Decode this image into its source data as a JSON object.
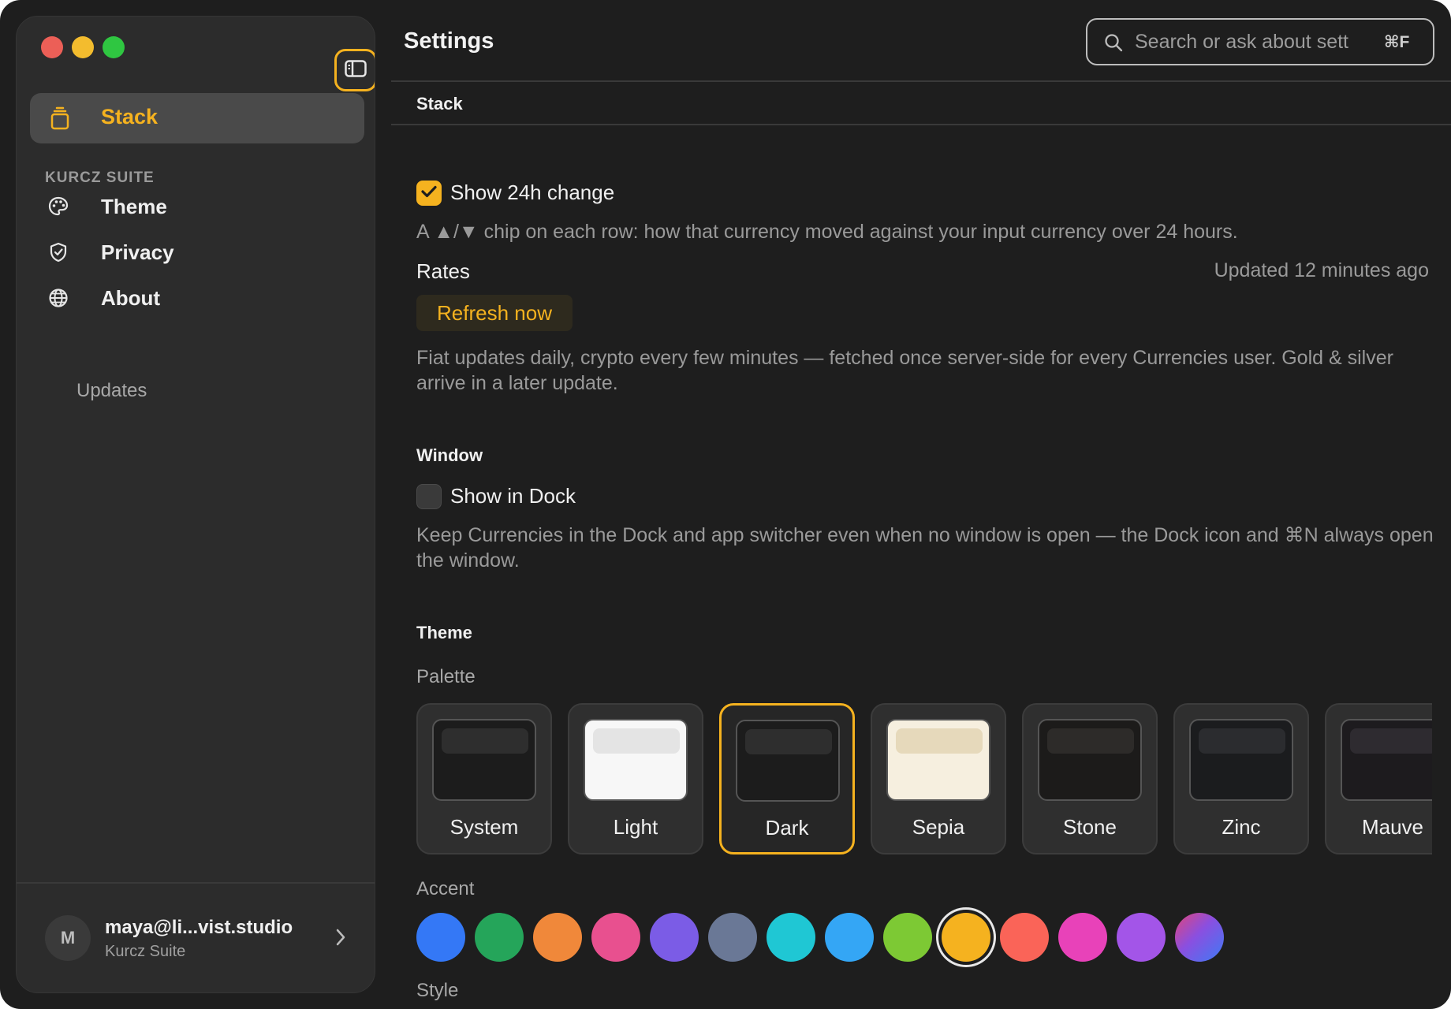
{
  "colors": {
    "accent": "#f5b21f",
    "window_bg": "#1e1e1e",
    "sidebar_bg": "#2c2c2c"
  },
  "sidebar": {
    "toggle_icon": "sidebar-toggle-icon",
    "active_item": {
      "label": "Stack",
      "icon": "stack-icon"
    },
    "section_label": "KURCZ SUITE",
    "items": [
      {
        "label": "Theme",
        "icon": "palette-icon"
      },
      {
        "label": "Privacy",
        "icon": "shield-icon"
      },
      {
        "label": "About",
        "icon": "globe-icon"
      }
    ],
    "sub_item": "Updates",
    "account": {
      "initial": "M",
      "email": "maya@li...vist.studio",
      "org": "Kurcz Suite"
    }
  },
  "header": {
    "title": "Settings",
    "search": {
      "placeholder": "Search or ask about sett",
      "shortcut": "⌘F"
    }
  },
  "stack": {
    "heading": "Stack",
    "show_24h": {
      "label": "Show 24h change",
      "checked": true,
      "description": "A ▲/▼ chip on each row: how that currency moved against your input currency over 24 hours."
    },
    "rates": {
      "label": "Rates",
      "updated": "Updated 12 minutes ago",
      "refresh_label": "Refresh now",
      "description": "Fiat updates daily, crypto every few minutes — fetched once server-side for every Currencies user. Gold & silver arrive in a later update."
    }
  },
  "window": {
    "heading": "Window",
    "show_in_dock": {
      "label": "Show in Dock",
      "checked": false,
      "description": "Keep Currencies in the Dock and app switcher even when no window is open — the Dock icon and ⌘N always open the window."
    }
  },
  "theme": {
    "heading": "Theme",
    "palette_label": "Palette",
    "palettes": [
      {
        "name": "System",
        "preview_bg": "#1c1c1c",
        "bar": "#2e2e2e",
        "selected": false
      },
      {
        "name": "Light",
        "preview_bg": "#f7f7f7",
        "bar": "#e4e4e4",
        "selected": false
      },
      {
        "name": "Dark",
        "preview_bg": "#1c1c1c",
        "bar": "#2e2e2e",
        "selected": true
      },
      {
        "name": "Sepia",
        "preview_bg": "#f6efdf",
        "bar": "#e6d9bb",
        "selected": false
      },
      {
        "name": "Stone",
        "preview_bg": "#1c1b1a",
        "bar": "#2d2b29",
        "selected": false
      },
      {
        "name": "Zinc",
        "preview_bg": "#1b1c1e",
        "bar": "#2b2c2f",
        "selected": false
      },
      {
        "name": "Mauve",
        "preview_bg": "#1d1b1e",
        "bar": "#2e2b30",
        "selected": false
      }
    ],
    "accent_label": "Accent",
    "accents": [
      {
        "color": "#3478f6",
        "selected": false
      },
      {
        "color": "#25a55a",
        "selected": false
      },
      {
        "color": "#f0883a",
        "selected": false
      },
      {
        "color": "#e8508f",
        "selected": false
      },
      {
        "color": "#7b5ce6",
        "selected": false
      },
      {
        "color": "#6a7896",
        "selected": false
      },
      {
        "color": "#1fc7d4",
        "selected": false
      },
      {
        "color": "#34a6f5",
        "selected": false
      },
      {
        "color": "#7dc934",
        "selected": false
      },
      {
        "color": "#f5b21f",
        "selected": true
      },
      {
        "color": "#fa6458",
        "selected": false
      },
      {
        "color": "#e842b9",
        "selected": false
      },
      {
        "color": "#a355e8",
        "selected": false
      },
      {
        "color": "gradient",
        "selected": false
      }
    ],
    "style_label": "Style"
  }
}
